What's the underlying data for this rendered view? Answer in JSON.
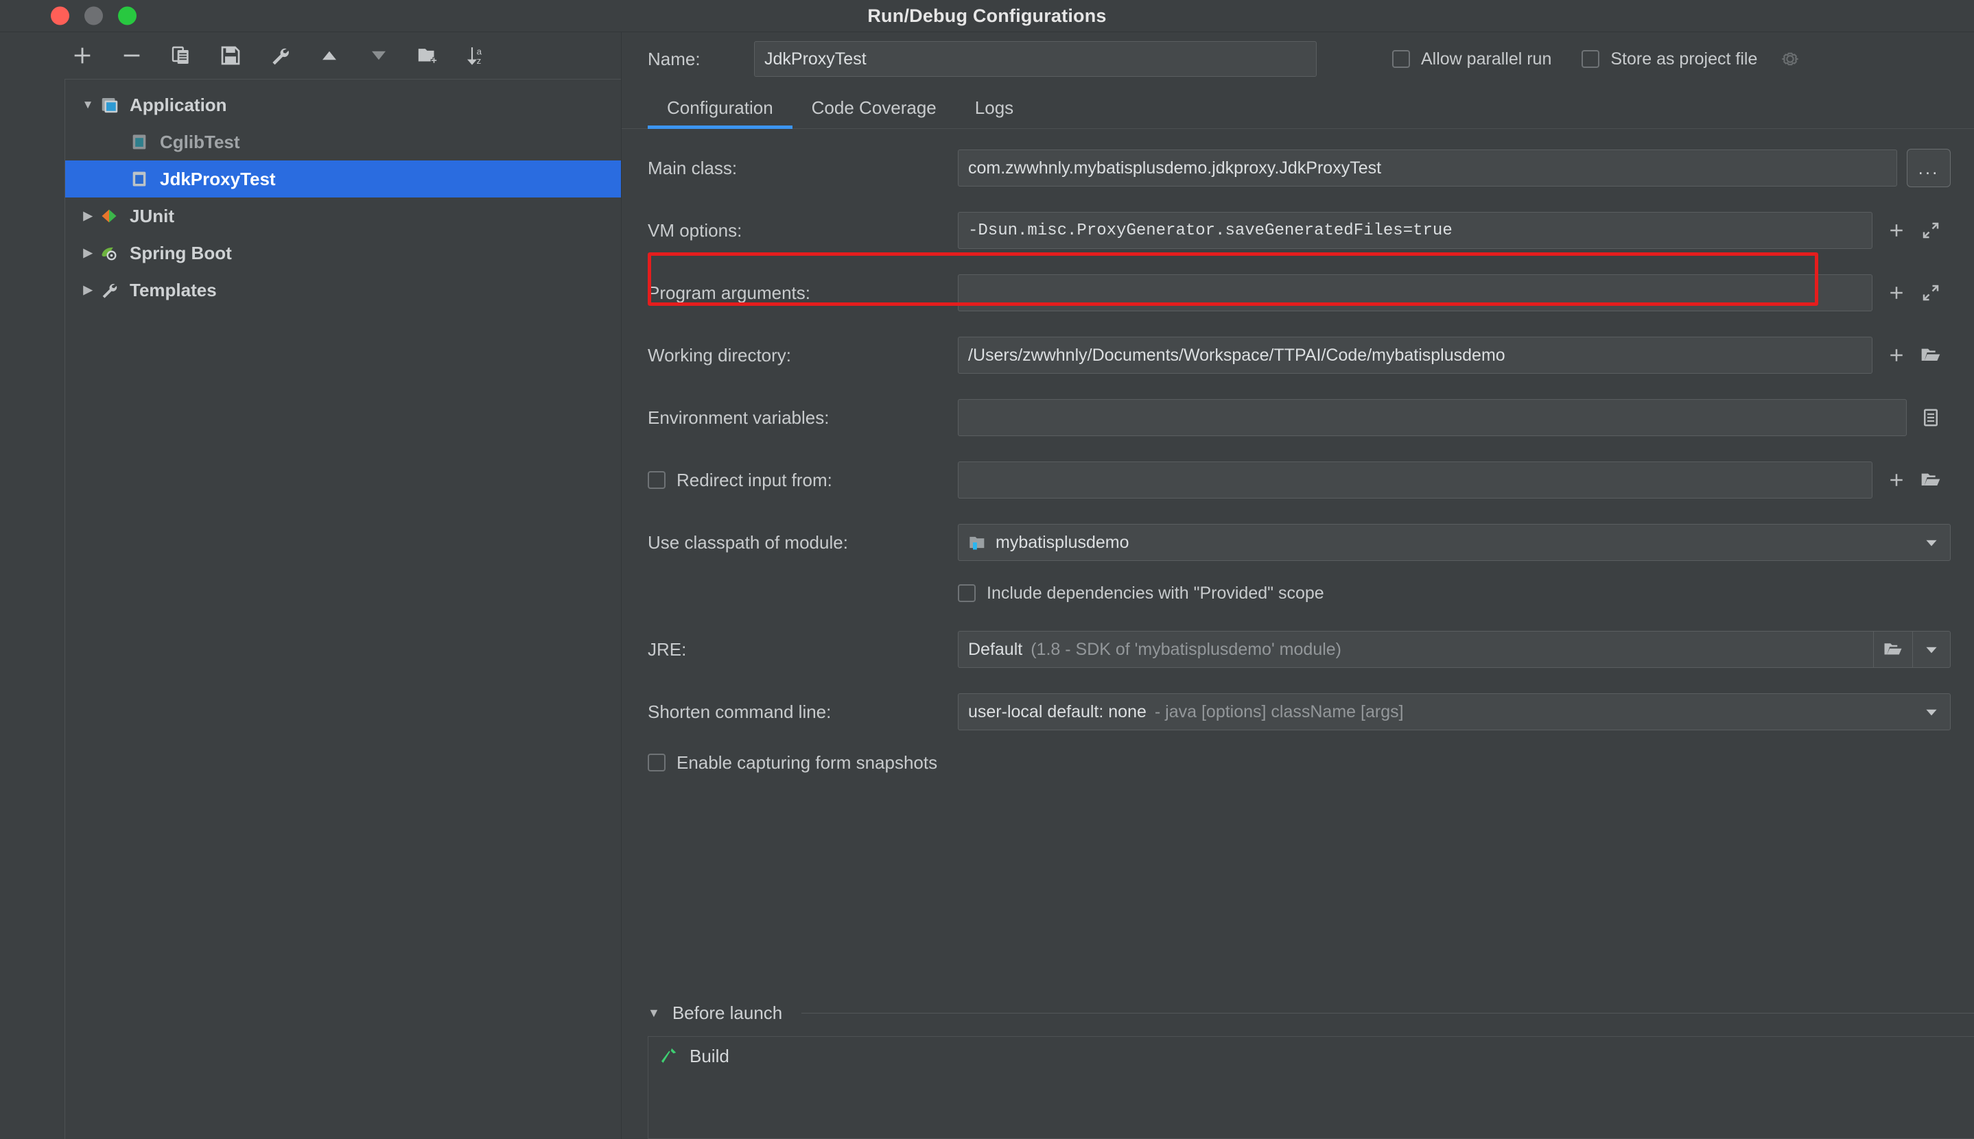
{
  "window": {
    "title": "Run/Debug Configurations",
    "traffic_lights": [
      "close",
      "minimize",
      "maximize"
    ]
  },
  "sidebar": {
    "toolbar": [
      {
        "name": "add-configuration-button",
        "icon": "plus-icon",
        "label": "+"
      },
      {
        "name": "remove-configuration-button",
        "icon": "minus-icon",
        "label": "−"
      },
      {
        "name": "copy-configuration-button",
        "icon": "copy-icon",
        "label": "Copy"
      },
      {
        "name": "save-configuration-button",
        "icon": "save-icon",
        "label": "Save"
      },
      {
        "name": "edit-defaults-button",
        "icon": "wrench-icon",
        "label": "Edit defaults"
      },
      {
        "name": "move-up-button",
        "icon": "arrow-up-icon",
        "label": "Move Up"
      },
      {
        "name": "move-down-button",
        "icon": "arrow-down-icon",
        "label": "Move Down"
      },
      {
        "name": "new-folder-button",
        "icon": "folder-add-icon",
        "label": "New Folder"
      },
      {
        "name": "sort-button",
        "icon": "sort-az-icon",
        "label": "Sort Configurations"
      }
    ],
    "tree": [
      {
        "label": "Application",
        "icon": "application-icon",
        "expanded": true,
        "level": 0,
        "selected": false,
        "dim": false
      },
      {
        "label": "CglibTest",
        "icon": "class-icon",
        "expanded": null,
        "level": 1,
        "selected": false,
        "dim": true
      },
      {
        "label": "JdkProxyTest",
        "icon": "class-icon",
        "expanded": null,
        "level": 1,
        "selected": true,
        "dim": false
      },
      {
        "label": "JUnit",
        "icon": "junit-icon",
        "expanded": false,
        "level": 0,
        "selected": false,
        "dim": false
      },
      {
        "label": "Spring Boot",
        "icon": "spring-boot-icon",
        "expanded": false,
        "level": 0,
        "selected": false,
        "dim": false
      },
      {
        "label": "Templates",
        "icon": "wrench-icon",
        "expanded": false,
        "level": 0,
        "selected": false,
        "dim": false
      }
    ]
  },
  "header": {
    "name_label": "Name:",
    "name_value": "JdkProxyTest",
    "allow_parallel_run": {
      "label": "Allow parallel run",
      "checked": false
    },
    "store_as_project_file": {
      "label": "Store as project file",
      "checked": false
    },
    "gear_icon": "gear-icon"
  },
  "tabs": [
    {
      "label": "Configuration",
      "active": true
    },
    {
      "label": "Code Coverage",
      "active": false
    },
    {
      "label": "Logs",
      "active": false
    }
  ],
  "form": {
    "main_class": {
      "label": "Main class:",
      "value": "com.zwwhnly.mybatisplusdemo.jdkproxy.JdkProxyTest",
      "browse_label": "..."
    },
    "vm_options": {
      "label": "VM options:",
      "value": "-Dsun.misc.ProxyGenerator.saveGeneratedFiles=true",
      "highlighted": true,
      "highlight_color": "#e51d1d"
    },
    "program_arguments": {
      "label": "Program arguments:",
      "value": ""
    },
    "working_directory": {
      "label": "Working directory:",
      "value": "/Users/zwwhnly/Documents/Workspace/TTPAI/Code/mybatisplusdemo"
    },
    "environment_variables": {
      "label": "Environment variables:",
      "value": ""
    },
    "redirect_input_from": {
      "label": "Redirect input from:",
      "checked": false,
      "value": ""
    },
    "use_classpath_of_module": {
      "label": "Use classpath of module:",
      "value": "mybatisplusdemo",
      "icon": "module-icon"
    },
    "include_provided_dependencies": {
      "label": "Include dependencies with \"Provided\" scope",
      "checked": false
    },
    "jre": {
      "label": "JRE:",
      "value": "Default",
      "hint": "(1.8 - SDK of 'mybatisplusdemo' module)"
    },
    "shorten_command_line": {
      "label": "Shorten command line:",
      "value": "user-local default: none",
      "hint": "- java [options] className [args]"
    },
    "enable_form_snapshots": {
      "label": "Enable capturing form snapshots",
      "checked": false
    }
  },
  "before_launch": {
    "title": "Before launch",
    "expanded": true,
    "items": [
      {
        "label": "Build",
        "icon": "build-hammer-icon"
      }
    ]
  },
  "colors": {
    "background": "#3c4042",
    "field_background": "#45494b",
    "selection": "#2a6ce0",
    "accent": "#3c95f0",
    "highlight": "#e51d1d",
    "text": "#c8cbcd",
    "text_dim": "#93979a"
  }
}
